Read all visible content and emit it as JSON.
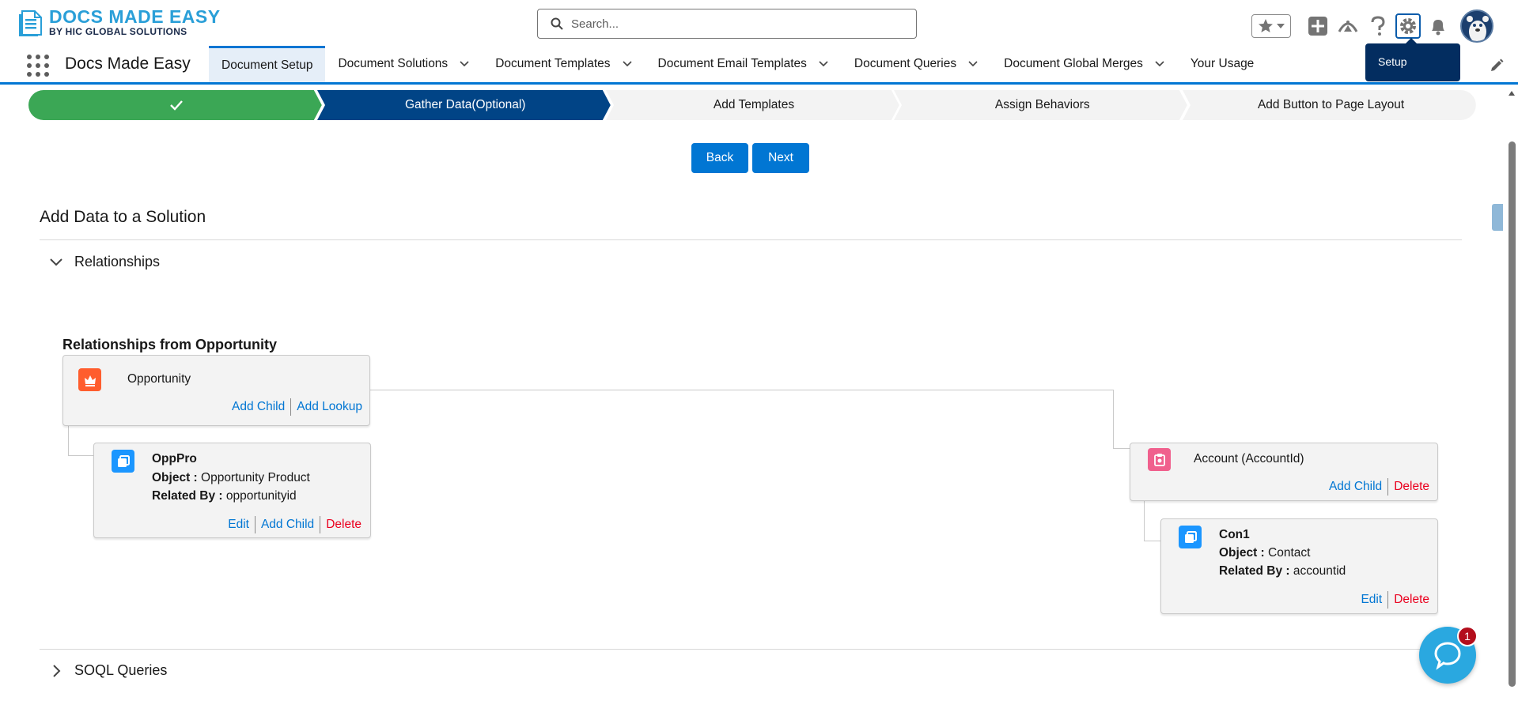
{
  "header": {
    "logo_main": "DOCS MADE EASY",
    "logo_sub": "BY HIC GLOBAL SOLUTIONS",
    "search_placeholder": "Search...",
    "tooltip": "Setup",
    "icons": [
      "star-icon",
      "chevron-down-icon",
      "add-icon",
      "trailhead-icon",
      "help-icon",
      "gear-icon",
      "bell-icon",
      "avatar"
    ]
  },
  "nav": {
    "app_name": "Docs Made Easy",
    "tabs": [
      {
        "label": "Document Setup",
        "active": true,
        "dropdown": false
      },
      {
        "label": "Document Solutions",
        "active": false,
        "dropdown": true
      },
      {
        "label": "Document Templates",
        "active": false,
        "dropdown": true
      },
      {
        "label": "Document Email Templates",
        "active": false,
        "dropdown": true
      },
      {
        "label": "Document Queries",
        "active": false,
        "dropdown": true
      },
      {
        "label": "Document Global Merges",
        "active": false,
        "dropdown": true
      },
      {
        "label": "Your Usage",
        "active": false,
        "dropdown": false
      }
    ]
  },
  "path": {
    "steps": [
      {
        "label": "",
        "status": "complete"
      },
      {
        "label": "Gather Data(Optional)",
        "status": "current"
      },
      {
        "label": "Add Templates",
        "status": "incomplete"
      },
      {
        "label": "Assign Behaviors",
        "status": "incomplete"
      },
      {
        "label": "Add Button to Page Layout",
        "status": "incomplete"
      }
    ]
  },
  "buttons": {
    "back": "Back",
    "next": "Next"
  },
  "section": {
    "title": "Add Data to a Solution",
    "relationships_label": "Relationships",
    "soql_label": "SOQL Queries"
  },
  "relationships": {
    "heading": "Relationships from Opportunity",
    "root": {
      "name": "Opportunity",
      "actions": [
        "Add Child",
        "Add Lookup"
      ]
    },
    "opppro": {
      "name": "OppPro",
      "object_label": "Object :",
      "object_value": "Opportunity Product",
      "related_label": "Related By :",
      "related_value": "opportunityid",
      "actions": [
        "Edit",
        "Add Child",
        "Delete"
      ]
    },
    "account": {
      "name": "Account (AccountId)",
      "actions": [
        "Add Child",
        "Delete"
      ]
    },
    "con1": {
      "name": "Con1",
      "object_label": "Object :",
      "object_value": "Contact",
      "related_label": "Related By :",
      "related_value": "accountid",
      "actions": [
        "Edit",
        "Delete"
      ]
    }
  },
  "chat": {
    "badge": "1"
  },
  "colors": {
    "brand_blue": "#0176d3",
    "path_complete": "#3ba755",
    "path_current": "#014486",
    "path_incomplete": "#f3f3f3",
    "delete_red": "#ea001e",
    "opportunity_icon": "#ff5d2d",
    "account_icon": "#f0608d",
    "custom_icon": "#1b96ff"
  }
}
